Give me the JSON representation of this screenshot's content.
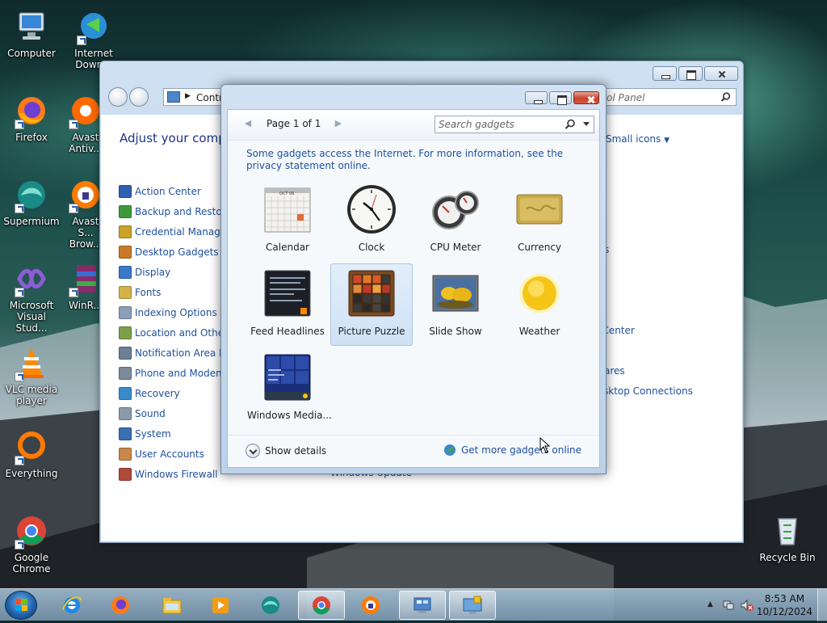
{
  "desktop": {
    "icons": [
      {
        "label": "Computer",
        "icon": "computer-icon"
      },
      {
        "label": "Internet Down...",
        "icon": "internet-download-manager-icon"
      },
      {
        "label": "Firefox",
        "icon": "firefox-icon"
      },
      {
        "label": "Avast Antiv...",
        "icon": "avast-antivirus-icon"
      },
      {
        "label": "Supermium",
        "icon": "supermium-icon"
      },
      {
        "label": "Avast S... Brow...",
        "icon": "avast-browser-icon"
      },
      {
        "label": "Microsoft Visual Stud...",
        "icon": "visual-studio-icon"
      },
      {
        "label": "WinR...",
        "icon": "winrar-icon"
      },
      {
        "label": "VLC media player",
        "icon": "vlc-icon"
      },
      {
        "label": "Everything",
        "icon": "everything-icon"
      },
      {
        "label": "Google Chrome",
        "icon": "chrome-icon"
      },
      {
        "label": "Recycle Bin",
        "icon": "recycle-bin-icon"
      }
    ]
  },
  "control_panel": {
    "address": "Contr",
    "search_placeholder": "ol Panel",
    "heading": "Adjust your compu",
    "view_by": "Small icons",
    "items": [
      {
        "label": "Action Center",
        "color": "#2f5fb0"
      },
      {
        "label": "Backup and Restore",
        "color": "#3c9a3a"
      },
      {
        "label": "Credential Manager",
        "color": "#c9a227"
      },
      {
        "label": "Desktop Gadgets",
        "color": "#c97a27"
      },
      {
        "label": "Display",
        "color": "#3a78c9"
      },
      {
        "label": "Fonts",
        "color": "#d4b24a"
      },
      {
        "label": "Indexing Options",
        "color": "#8aa0b8"
      },
      {
        "label": "Location and Other",
        "color": "#7da04a"
      },
      {
        "label": "Notification Area Ico",
        "color": "#6c7f95"
      },
      {
        "label": "Phone and Modem",
        "color": "#7d8a99"
      },
      {
        "label": "Recovery",
        "color": "#3a8acb"
      },
      {
        "label": "Sound",
        "color": "#8b9aab"
      },
      {
        "label": "System",
        "color": "#3a6fb5"
      },
      {
        "label": "User Accounts",
        "color": "#c9874a"
      },
      {
        "label": "Windows Firewall",
        "color": "#b04a3a"
      }
    ],
    "right_items": [
      "s",
      "g Center",
      "ares",
      "sktop Connections"
    ],
    "bottom_item": "Windows Update"
  },
  "gadgets_window": {
    "page_text": "Page 1 of 1",
    "search_placeholder": "Search gadgets",
    "notice": "Some gadgets access the Internet.  For more information, see the privacy statement online.",
    "gadgets": [
      {
        "label": "Calendar",
        "selected": false
      },
      {
        "label": "Clock",
        "selected": false
      },
      {
        "label": "CPU Meter",
        "selected": false
      },
      {
        "label": "Currency",
        "selected": false
      },
      {
        "label": "Feed Headlines",
        "selected": false
      },
      {
        "label": "Picture Puzzle",
        "selected": true
      },
      {
        "label": "Slide Show",
        "selected": false
      },
      {
        "label": "Weather",
        "selected": false
      },
      {
        "label": "Windows Media...",
        "selected": false
      }
    ],
    "calendar_month": "OCT 06",
    "show_details": "Show details",
    "get_more": "Get more gadgets online"
  },
  "taskbar": {
    "apps": [
      {
        "icon": "internet-explorer-icon",
        "open": false
      },
      {
        "icon": "firefox-icon",
        "open": false
      },
      {
        "icon": "file-explorer-icon",
        "open": false
      },
      {
        "icon": "media-player-icon",
        "open": false
      },
      {
        "icon": "supermium-icon",
        "open": false
      },
      {
        "icon": "chrome-icon",
        "open": true
      },
      {
        "icon": "avast-browser-icon",
        "open": false
      },
      {
        "icon": "control-panel-icon",
        "open": true
      },
      {
        "icon": "gadgets-icon",
        "open": true
      }
    ],
    "time": "8:53 AM",
    "date": "10/12/2024"
  }
}
